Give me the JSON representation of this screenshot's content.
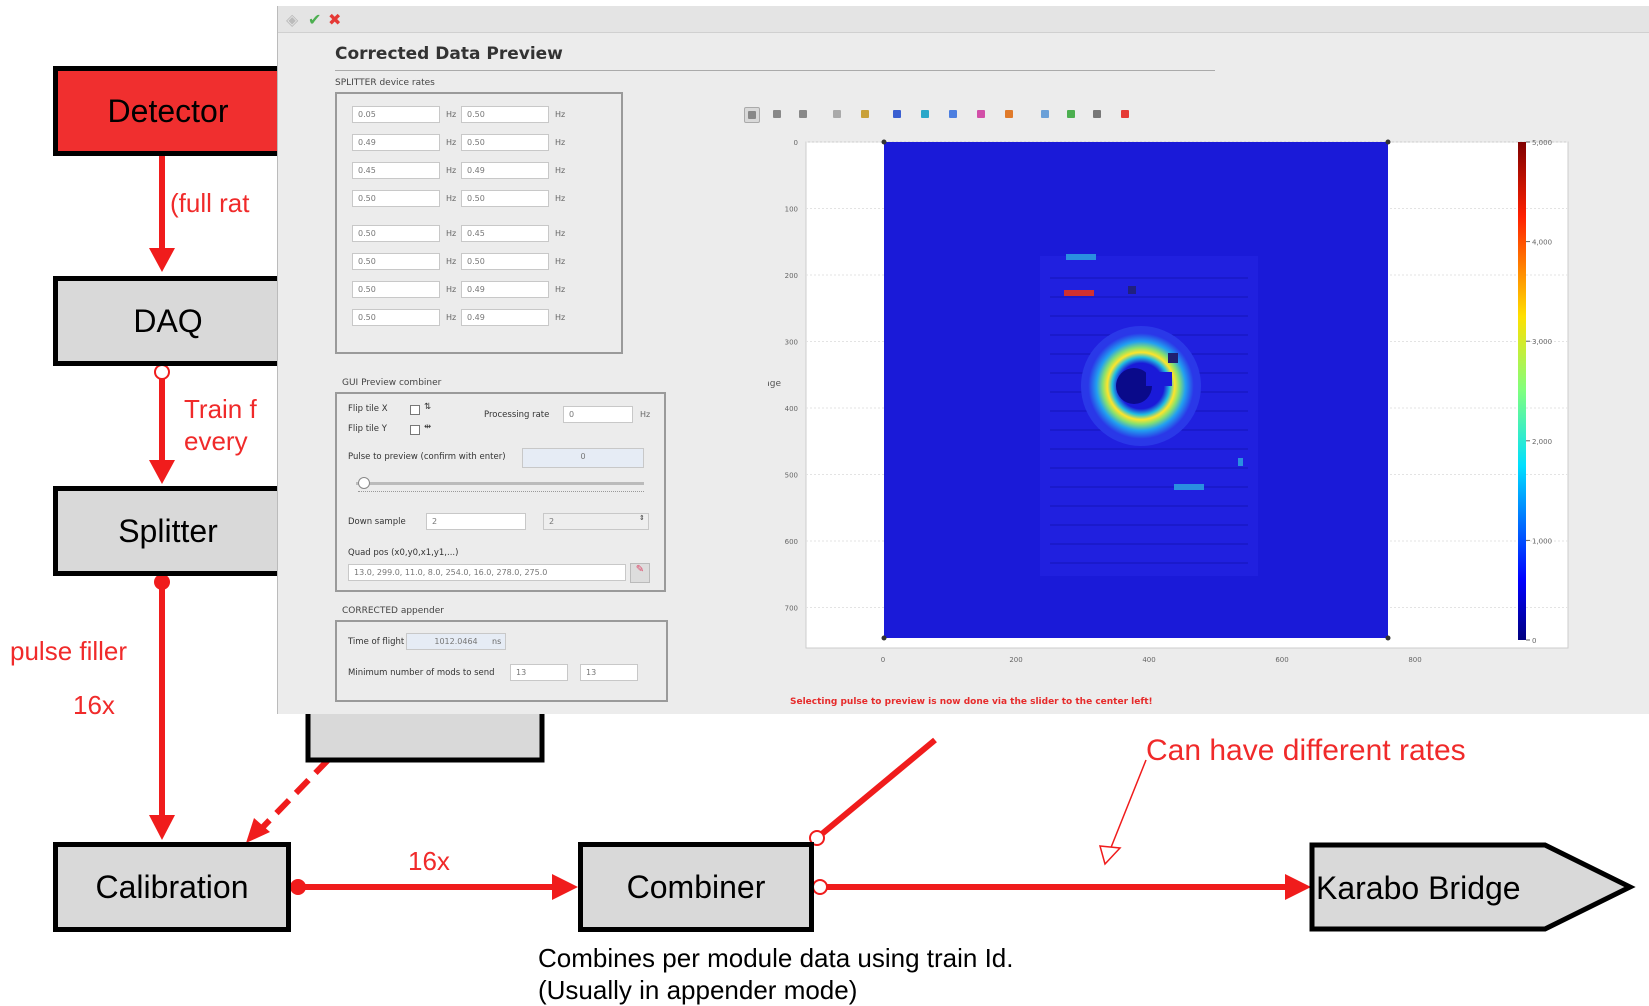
{
  "diagram": {
    "nodes": {
      "detector": "Detector",
      "daq": "DAQ",
      "splitter": "Splitter",
      "calibration": "Calibration",
      "combiner": "Combiner",
      "bridge": "Karabo Bridge"
    },
    "edge_labels": {
      "full_rate": "(full rat",
      "train_line1": "Train f",
      "train_line2": "every",
      "pulse_filler": "pulse filler",
      "sixteen_left": "16x",
      "sixteen_mid": "16x",
      "different_rates": "Can have different rates"
    },
    "combiner_note": [
      "Combines per module data using train Id.",
      "(Usually in appender mode)"
    ],
    "colors": {
      "edge": "#f01c1c",
      "label": "#f02a2a",
      "detector_fill": "#f02f2f",
      "box_fill": "#d9d9d9"
    }
  },
  "window": {
    "title": "Corrected Data Preview",
    "titlebar_icons": [
      "pin-icon",
      "check-icon",
      "close-icon"
    ],
    "splitter_group": {
      "label": "SPLITTER device rates",
      "unit": "Hz",
      "rows": [
        [
          "0.05",
          "0.50"
        ],
        [
          "0.49",
          "0.50"
        ],
        [
          "0.45",
          "0.49"
        ],
        [
          "0.50",
          "0.50"
        ],
        [
          "0.50",
          "0.45"
        ],
        [
          "0.50",
          "0.50"
        ],
        [
          "0.50",
          "0.49"
        ],
        [
          "0.50",
          "0.49"
        ]
      ]
    },
    "combiner_group": {
      "label": "GUI Preview combiner",
      "flip_x": "Flip tile X",
      "flip_y": "Flip tile Y",
      "processing_rate_label": "Processing rate",
      "processing_rate_value": "0",
      "processing_rate_unit": "Hz",
      "pulse_label": "Pulse to preview (confirm with enter)",
      "pulse_value": "0",
      "downsample_label": "Down sample",
      "downsample_value": "2",
      "downsample_select": "2",
      "quad_label": "Quad pos (x0,y0,x1,y1,...)",
      "quad_value": "13.0, 299.0, 11.0, 8.0, 254.0, 16.0, 278.0, 275.0"
    },
    "appender_group": {
      "label": "CORRECTED appender",
      "tof_label": "Time of flight",
      "tof_value": "1012.0464",
      "tof_unit": "ns",
      "minmods_label": "Minimum number of mods to send",
      "minmods_value1": "13",
      "minmods_value2": "13"
    },
    "plot": {
      "ylabel": "image",
      "x_ticks": [
        "0",
        "200",
        "400",
        "600",
        "800"
      ],
      "y_ticks": [
        "0",
        "100",
        "200",
        "300",
        "400",
        "500",
        "600",
        "700"
      ],
      "colorbar_ticks": [
        "0",
        "1,000",
        "2,000",
        "3,000",
        "4,000",
        "5,000"
      ],
      "toolbar_icons": [
        "pointer-icon",
        "zoom-icon",
        "pan-icon",
        "select-icon",
        "axes-icon",
        "colormap-icon",
        "contrast-icon",
        "image-icon",
        "roi-icon",
        "lut-icon",
        "export-icon",
        "save-icon",
        "print-icon",
        "reset-icon"
      ],
      "hint": "Selecting pulse to preview is now done via the slider to the center left!"
    }
  }
}
